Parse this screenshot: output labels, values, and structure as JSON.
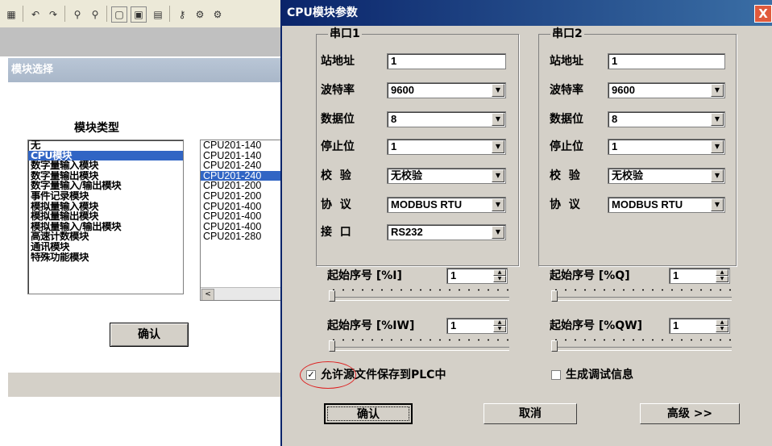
{
  "toolbar": {
    "icons": [
      "grid-icon",
      "undo-icon",
      "redo-icon",
      "binoculars-icon",
      "find-replace-icon",
      "window-icon",
      "image-window-icon",
      "table-icon",
      "search-key-icon",
      "tools-icon",
      "tools2-icon"
    ],
    "glyphs": [
      "▦",
      "↶",
      "↷",
      "⚲",
      "⚲",
      "▢",
      "▣",
      "▤",
      "⚷",
      "⚙",
      "⚙"
    ]
  },
  "module_window": {
    "title": "模块选择",
    "type_label": "模块类型",
    "types": [
      "无",
      "CPU模块",
      "数字量输入模块",
      "数字量输出模块",
      "数字量输入/输出模块",
      "事件记录模块",
      "模拟量输入模块",
      "模拟量输出模块",
      "模拟量输入/输出模块",
      "高速计数模块",
      "通讯模块",
      "特殊功能模块"
    ],
    "selected_type_index": 1,
    "cpu_models": [
      "CPU201-140",
      "CPU201-140",
      "CPU201-240",
      "CPU201-240",
      "CPU201-200",
      "CPU201-200",
      "CPU201-400",
      "CPU201-400",
      "CPU201-400",
      "CPU201-280"
    ],
    "selected_cpu_index": 3,
    "scroll_left_glyph": "<",
    "confirm_label": "确认"
  },
  "dialog": {
    "title": "CPU模块参数",
    "close_glyph": "X",
    "port1": {
      "legend": "串口1",
      "station_label": "站地址",
      "station_value": "1",
      "baud_label": "波特率",
      "baud_value": "9600",
      "databits_label": "数据位",
      "databits_value": "8",
      "stopbits_label": "停止位",
      "stopbits_value": "1",
      "parity_label": "校  验",
      "parity_value": "无校验",
      "protocol_label": "协  议",
      "protocol_value": "MODBUS RTU",
      "interface_label": "接  口",
      "interface_value": "RS232"
    },
    "port2": {
      "legend": "串口2",
      "station_label": "站地址",
      "station_value": "1",
      "baud_label": "波特率",
      "baud_value": "9600",
      "databits_label": "数据位",
      "databits_value": "8",
      "stopbits_label": "停止位",
      "stopbits_value": "1",
      "parity_label": "校  验",
      "parity_value": "无校验",
      "protocol_label": "协  议",
      "protocol_value": "MODBUS RTU"
    },
    "start_i_label": "起始序号 [%I]",
    "start_i_value": "1",
    "start_q_label": "起始序号 [%Q]",
    "start_q_value": "1",
    "start_iw_label": "起始序号 [%IW]",
    "start_iw_value": "1",
    "start_qw_label": "起始序号 [%QW]",
    "start_qw_value": "1",
    "save_source_label": "允许源文件保存到PLC中",
    "save_source_checked": true,
    "check_glyph": "✓",
    "debug_info_label": "生成调试信息",
    "debug_info_checked": false,
    "confirm_label": "确认",
    "cancel_label": "取消",
    "advanced_label": "高级 >>",
    "dropdown_glyph": "▼",
    "spin_up_glyph": "▲",
    "spin_down_glyph": "▼"
  }
}
